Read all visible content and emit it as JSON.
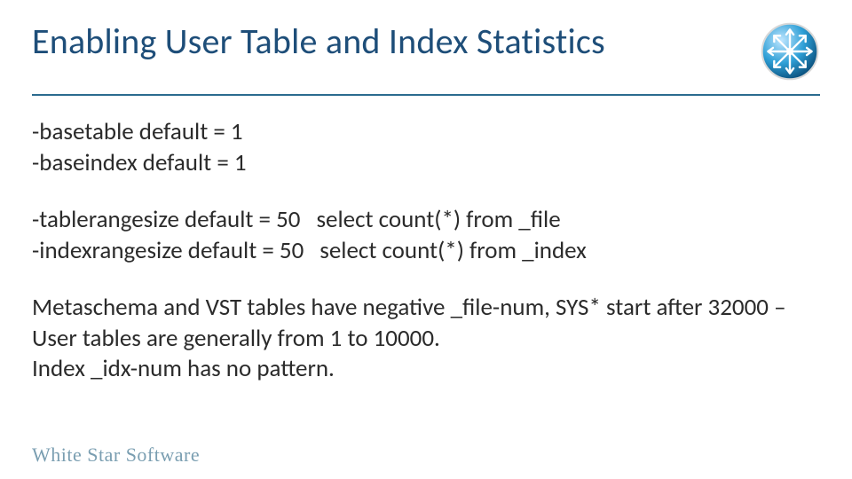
{
  "title": "Enabling User Table and Index Statistics",
  "logo_alt": "snowflake-badge-icon",
  "lines": {
    "basetable": "-basetable default = 1",
    "baseindex": "-baseindex default = 1",
    "tablerange_left": "-tablerangesize default = 50",
    "tablerange_right": "select count(*) from _file",
    "indexrange_left": "-indexrangesize default = 50",
    "indexrange_right": "select count(*) from _index",
    "para1": "Metaschema and VST tables have negative _file-num, SYS* start after 32000 – User tables are generally from 1 to 10000.",
    "para2": "Index _idx-num has no pattern."
  },
  "footer": "White Star Software"
}
